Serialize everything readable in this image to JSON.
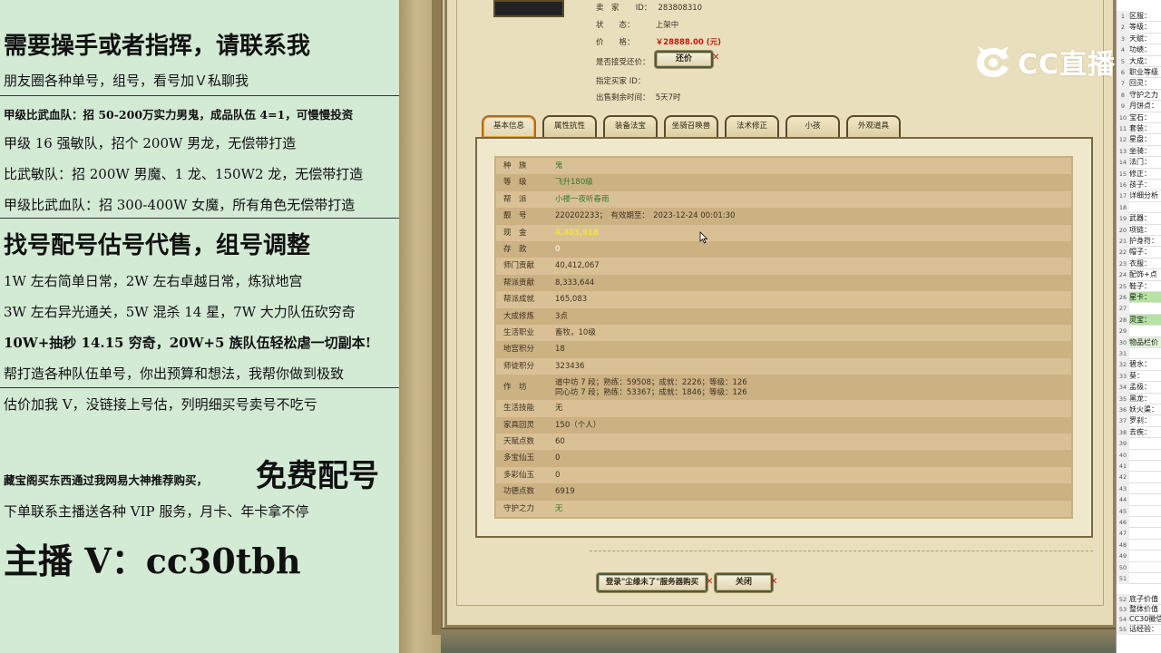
{
  "ad_panel": {
    "headline1": "需要操手或者指挥，请联系我",
    "line1": "朋友圈各种单号，组号，看号加Ｖ私聊我",
    "line2": "甲级比武血队：招 50-200万实力男鬼，成品队伍 4=1，可慢慢投资",
    "line3": "甲级 16 强敏队，招个 200W 男龙，无偿带打造",
    "line4": "比武敏队：招 200W 男魔、1 龙、150W2 龙，无偿带打造",
    "line5": "甲级比武血队：招 300-400W 女魔，所有角色无偿带打造",
    "headline2": "找号配号估号代售，组号调整",
    "line6": "1W 左右简单日常，2W 左右卓越日常，炼狱地宫",
    "line7": "3W 左右异光通关，5W 混杀 14 星，7W 大力队伍砍穷奇",
    "line8": "10W+抽秒 14.15 穷奇，20W+5 族队伍轻松虐一切副本!",
    "line9": "帮打造各种队伍单号，你出预算和想法，我帮你做到极致",
    "line10": "估价加我 V，没链接上号估，列明细买号卖号不吃亏",
    "line11": "藏宝阁买东西通过我网易大神推荐购买，",
    "free": "免费配号",
    "line12": "下单联系主播送各种 VIP 服务，月卡、年卡拿不停",
    "contact": "主播 V：cc30tbh"
  },
  "seller": {
    "seller_label": "卖　家",
    "seller_id_label": "ID：",
    "seller_id": "283808310",
    "status_label": "状　　态：",
    "status": "上架中",
    "price_label": "价　　格：",
    "price": "￥28888.00 (元)",
    "counter_label": "是否接受还价：",
    "counter_button": "还价",
    "buyer_label": "指定买家 ID：",
    "time_label": "出售剩余时间：",
    "time_left": "5天7时"
  },
  "tabs": [
    "基本信息",
    "属性抗性",
    "装备法宝",
    "坐骑召唤兽",
    "法术修正",
    "小孩",
    "外观道具"
  ],
  "basic_info": [
    {
      "label": "种　族",
      "value": "鬼",
      "style": "green"
    },
    {
      "label": "等　级",
      "value": "飞升180级",
      "style": "green"
    },
    {
      "label": "帮　派",
      "value": "小楼一夜听春雨",
      "style": "green"
    },
    {
      "label": "靓　号",
      "value": "220202233；　有效期至：　2023-12-24 00:01:30",
      "style": "dark"
    },
    {
      "label": "现　金",
      "value": "4,403,918",
      "style": "yellow"
    },
    {
      "label": "存　款",
      "value": "0",
      "style": "white"
    },
    {
      "label": "师门贡献",
      "value": "40,412,067",
      "style": "dark"
    },
    {
      "label": "帮派贡献",
      "value": "8,333,644",
      "style": "dark"
    },
    {
      "label": "帮派成就",
      "value": "165,083",
      "style": "dark"
    },
    {
      "label": "大成修炼",
      "value": "3点",
      "style": "dark"
    },
    {
      "label": "生活职业",
      "value": "畜牧，10级",
      "style": "dark"
    },
    {
      "label": "地宫积分",
      "value": "18",
      "style": "dark"
    },
    {
      "label": "师徒积分",
      "value": "323436",
      "style": "dark"
    },
    {
      "label": "作　坊",
      "value": "道中坊 7 段；熟练：59508；成就：2226；等级：126",
      "value2": "同心坊 7 段；熟练：53367；成就：1846；等级：126",
      "style": "dark"
    },
    {
      "label": "生活技能",
      "value": "无",
      "style": "dark"
    },
    {
      "label": "家具回灵",
      "value": "150（个人）",
      "style": "dark"
    },
    {
      "label": "天赋点数",
      "value": "60",
      "style": "dark"
    },
    {
      "label": "多宝仙玉",
      "value": "0",
      "style": "dark"
    },
    {
      "label": "多彩仙玉",
      "value": "0",
      "style": "dark"
    },
    {
      "label": "功德点数",
      "value": "6919",
      "style": "dark"
    },
    {
      "label": "守护之力",
      "value": "无",
      "style": "green"
    }
  ],
  "bottom_buttons": {
    "login": "登录\"尘缘未了\"服务器购买",
    "close": "关闭"
  },
  "watermark": "CC直播",
  "sheet_rows": [
    {
      "n": "1",
      "t": "区服："
    },
    {
      "n": "2",
      "t": "等级："
    },
    {
      "n": "3",
      "t": "天赋："
    },
    {
      "n": "4",
      "t": "功绩："
    },
    {
      "n": "5",
      "t": "大成："
    },
    {
      "n": "6",
      "t": "职业等级"
    },
    {
      "n": "7",
      "t": "回灵："
    },
    {
      "n": "8",
      "t": "守护之力"
    },
    {
      "n": "9",
      "t": "月饼点："
    },
    {
      "n": "10",
      "t": "宝石："
    },
    {
      "n": "11",
      "t": "套装："
    },
    {
      "n": "12",
      "t": "星盘："
    },
    {
      "n": "13",
      "t": "坐骑："
    },
    {
      "n": "14",
      "t": "法门："
    },
    {
      "n": "15",
      "t": "修正："
    },
    {
      "n": "16",
      "t": "孩子："
    },
    {
      "n": "17",
      "t": "详细分析"
    },
    {
      "n": "18",
      "t": ""
    },
    {
      "n": "19",
      "t": "武器："
    },
    {
      "n": "20",
      "t": "项链："
    },
    {
      "n": "21",
      "t": "护身符："
    },
    {
      "n": "22",
      "t": "帽子："
    },
    {
      "n": "23",
      "t": "衣服："
    },
    {
      "n": "24",
      "t": "配饰+点"
    },
    {
      "n": "25",
      "t": "鞋子："
    },
    {
      "n": "26",
      "t": "星卡：",
      "c": "green"
    },
    {
      "n": "27",
      "t": ""
    },
    {
      "n": "28",
      "t": "灵宝：",
      "c": "green"
    },
    {
      "n": "29",
      "t": ""
    },
    {
      "n": "30",
      "t": "物品栏价",
      "c": "lightgreen"
    },
    {
      "n": "31",
      "t": ""
    },
    {
      "n": "32",
      "t": "碧水："
    },
    {
      "n": "33",
      "t": "葵："
    },
    {
      "n": "34",
      "t": "孟极："
    },
    {
      "n": "35",
      "t": "黑龙："
    },
    {
      "n": "36",
      "t": "妖火渠："
    },
    {
      "n": "37",
      "t": "罗刹："
    },
    {
      "n": "38",
      "t": "去疾："
    },
    {
      "n": "39",
      "t": ""
    },
    {
      "n": "40",
      "t": ""
    },
    {
      "n": "41",
      "t": ""
    },
    {
      "n": "42",
      "t": ""
    },
    {
      "n": "43",
      "t": ""
    },
    {
      "n": "44",
      "t": ""
    },
    {
      "n": "45",
      "t": ""
    },
    {
      "n": "46",
      "t": ""
    },
    {
      "n": "47",
      "t": ""
    },
    {
      "n": "48",
      "t": ""
    },
    {
      "n": "49",
      "t": ""
    },
    {
      "n": "50",
      "t": ""
    },
    {
      "n": "51",
      "t": ""
    },
    {
      "n": "52",
      "t": "底子价值"
    },
    {
      "n": "53",
      "t": "整体价值"
    },
    {
      "n": "54",
      "t": "CC30徽信"
    },
    {
      "n": "55",
      "t": "话经验："
    }
  ]
}
